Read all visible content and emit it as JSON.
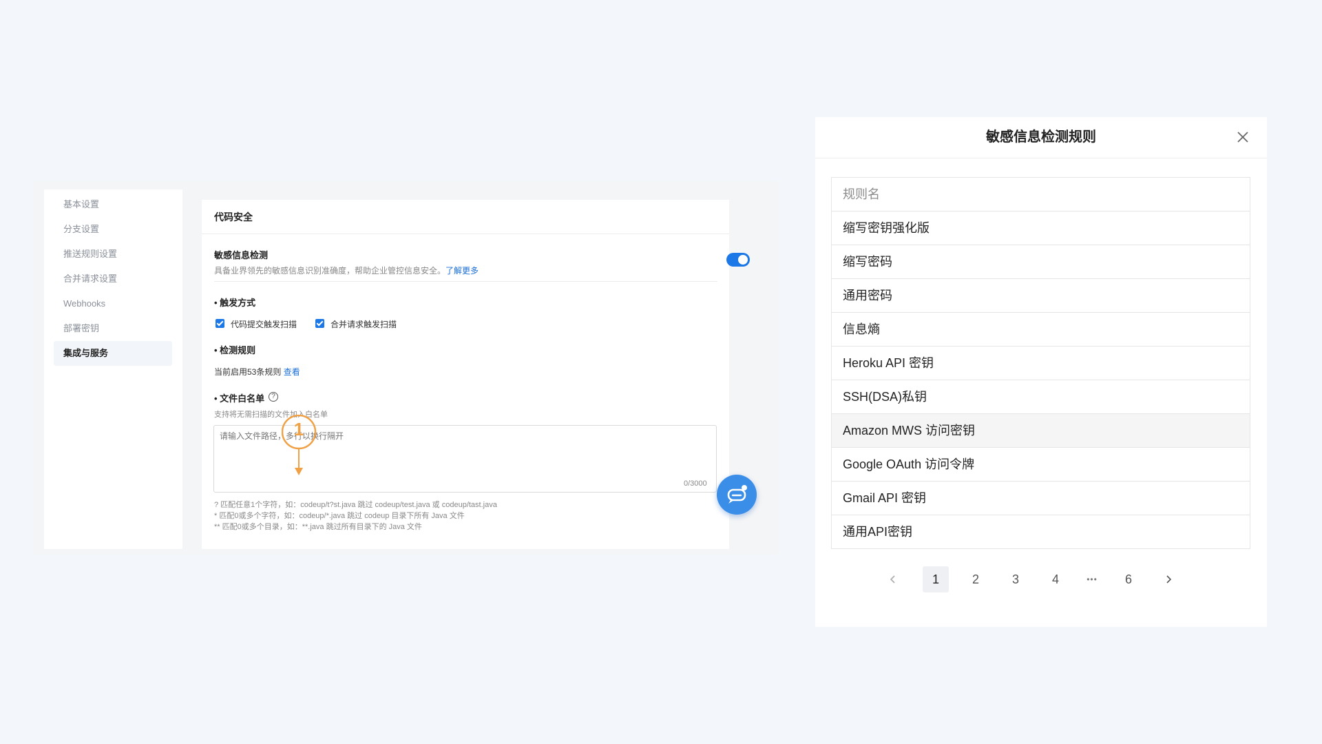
{
  "settings": {
    "sidebar": {
      "items": [
        {
          "label": "基本设置"
        },
        {
          "label": "分支设置"
        },
        {
          "label": "推送规则设置"
        },
        {
          "label": "合并请求设置"
        },
        {
          "label": "Webhooks"
        },
        {
          "label": "部署密钥"
        },
        {
          "label": "集成与服务",
          "active": true
        }
      ]
    },
    "card": {
      "title": "代码安全",
      "sensitive_title": "敏感信息检测",
      "sensitive_desc": "具备业界领先的敏感信息识别准确度，帮助企业管控信息安全。",
      "learn_more": "了解更多",
      "toggle_on": true,
      "trigger_title": "• 触发方式",
      "trigger_commit": "代码提交触发扫描",
      "trigger_mr": "合并请求触发扫描",
      "rules_title": "• 检测规则",
      "rules_status": "当前启用53条规则",
      "rules_view": "查看",
      "whitelist_title": "• 文件白名单",
      "whitelist_help": "?",
      "whitelist_desc": "支持将无需扫描的文件加入白名单",
      "whitelist_placeholder": "请输入文件路径，多行以换行隔开",
      "counter": "0/3000",
      "hints": [
        "?   匹配任意1个字符，如：codeup/t?st.java 跳过 codeup/test.java 或 codeup/tast.java",
        "*    匹配0或多个字符，如：codeup/*.java 跳过 codeup 目录下所有 Java 文件",
        "**  匹配0或多个目录，如：**.java 跳过所有目录下的 Java 文件"
      ]
    },
    "annotation_number": "1",
    "accent": "#1b78e6",
    "annotation_color": "#f0a045"
  },
  "dialog": {
    "title": "敏感信息检测规则",
    "column_header": "规则名",
    "rules": [
      "缩写密钥强化版",
      "缩写密码",
      "通用密码",
      "信息熵",
      "Heroku API 密钥",
      "SSH(DSA)私钥",
      "Amazon MWS 访问密钥",
      "Google OAuth 访问令牌",
      "Gmail API 密钥",
      "通用API密钥"
    ],
    "pagination": {
      "pages": [
        "1",
        "2",
        "3",
        "4",
        "•••",
        "6"
      ],
      "current": "1"
    }
  }
}
